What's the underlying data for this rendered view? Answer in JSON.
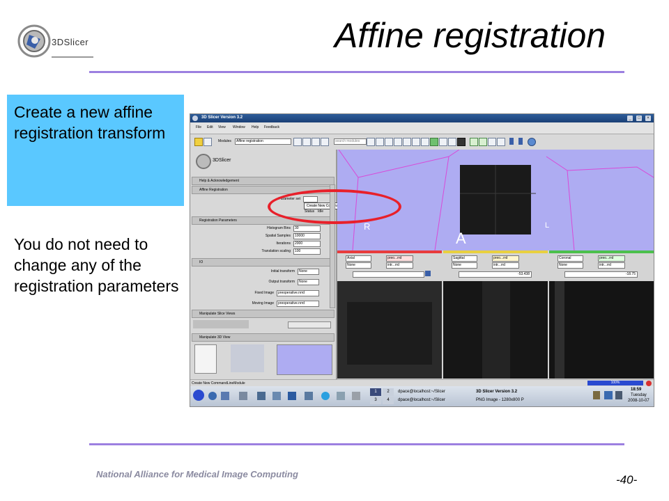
{
  "slide": {
    "title": "Affine registration",
    "logo_text": "3DSlicer",
    "callout": "Create a new affine registration transform",
    "note": "You do not need to change any of the registration parameters",
    "footer_org": "National Alliance for Medical Image Computing",
    "page_number": "-40-",
    "accent_color": "#9c7fe0",
    "callout_color": "#5ac8ff",
    "annotation_color": "#e8202a"
  },
  "app": {
    "window_title": "3D Slicer Version 3.2",
    "menus": [
      "File",
      "Edit",
      "View",
      "Window",
      "Help",
      "Feedback"
    ],
    "modules_label": "Modules",
    "module_selected": "Affine registration",
    "search_placeholder": "search modules",
    "logo_text": "3DSlicer",
    "sections": {
      "help": "Help & Acknowledgement",
      "affine": "Affine Registration",
      "reg_params": "Registration Parameters",
      "io": "IO",
      "slice_views": "Manipulate Slice Views",
      "view3d": "Manipulate 3D View"
    },
    "parameter_set_label": "Parameter set",
    "parameter_set_value": "",
    "dropdown_option": "Create New CommandLineModule",
    "status_label": "Status",
    "status_value": "Idle",
    "params": [
      {
        "label": "Histogram Bins",
        "value": "30"
      },
      {
        "label": "Spatial Samples",
        "value": "10000"
      },
      {
        "label": "Iterations",
        "value": "2000"
      },
      {
        "label": "Translation scaling",
        "value": "100"
      }
    ],
    "io_fields": [
      {
        "label": "Initial transform",
        "value": "None"
      },
      {
        "label": "Output transform",
        "value": "None"
      },
      {
        "label": "Fixed Image",
        "value": "preoperative.nrrd"
      },
      {
        "label": "Moving Image",
        "value": "preoperative.nrrd"
      }
    ],
    "view3d_labels": {
      "r": "R",
      "l": "L",
      "a": "A"
    },
    "slices": [
      {
        "name": "Axial",
        "fg": "preo...rrd",
        "bg": "None",
        "lb": "intr...rrd",
        "offset": "",
        "color": "#e83c3c"
      },
      {
        "name": "Sagittal",
        "fg": "preo...rrd",
        "bg": "None",
        "lb": "intr...rrd",
        "offset": "-53.438",
        "color": "#e8d040"
      },
      {
        "name": "Coronal",
        "fg": "preo...rrd",
        "bg": "None",
        "lb": "intr...rrd",
        "offset": "-18.75",
        "color": "#4cc04c"
      }
    ],
    "status_bar": "Create New CommandLineModule",
    "progress": "100%",
    "taskbar": {
      "workspaces": [
        "1",
        "2",
        "3",
        "4"
      ],
      "tasks": [
        "dpace@localhost:~/Slicer",
        "3D Slicer Version 3.2",
        "dpace@localhost:~/Slicer",
        "PNG Image - 1280x800 P"
      ],
      "time": "18:59",
      "day": "Tuesday",
      "date": "2008-10-07"
    }
  }
}
